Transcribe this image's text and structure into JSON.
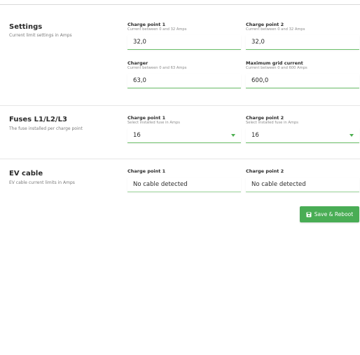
{
  "settings": {
    "title": "Settings",
    "description": "Current limit settings in Amps",
    "fields": [
      {
        "label": "Charge point 1",
        "help": "Current between 0 and 32 Amps",
        "value": "32,0"
      },
      {
        "label": "Charge point 2",
        "help": "Current between 0 and 32 Amps",
        "value": "32,0"
      },
      {
        "label": "Charger",
        "help": "Current between 0 and 63 Amps",
        "value": "63,0"
      },
      {
        "label": "Maximum grid current",
        "help": "Current between 0 and 600 Amps",
        "value": "600,0"
      }
    ]
  },
  "fuses": {
    "title": "Fuses L1/L2/L3",
    "description": "The fuse installed per charge point",
    "fields": [
      {
        "label": "Charge point 1",
        "help": "Select installed fuse in Amps",
        "value": "16"
      },
      {
        "label": "Charge point 2",
        "help": "Select installed fuse in Amps",
        "value": "16"
      }
    ]
  },
  "ev_cable": {
    "title": "EV cable",
    "description": "EV cable current limits in Amps",
    "fields": [
      {
        "label": "Charge point 1",
        "value": "No cable detected"
      },
      {
        "label": "Charge point 2",
        "value": "No cable detected"
      }
    ]
  },
  "actions": {
    "save_label": "Save & Reboot",
    "save_icon": "floppy-disk-icon",
    "accent_color": "#49ad55"
  }
}
